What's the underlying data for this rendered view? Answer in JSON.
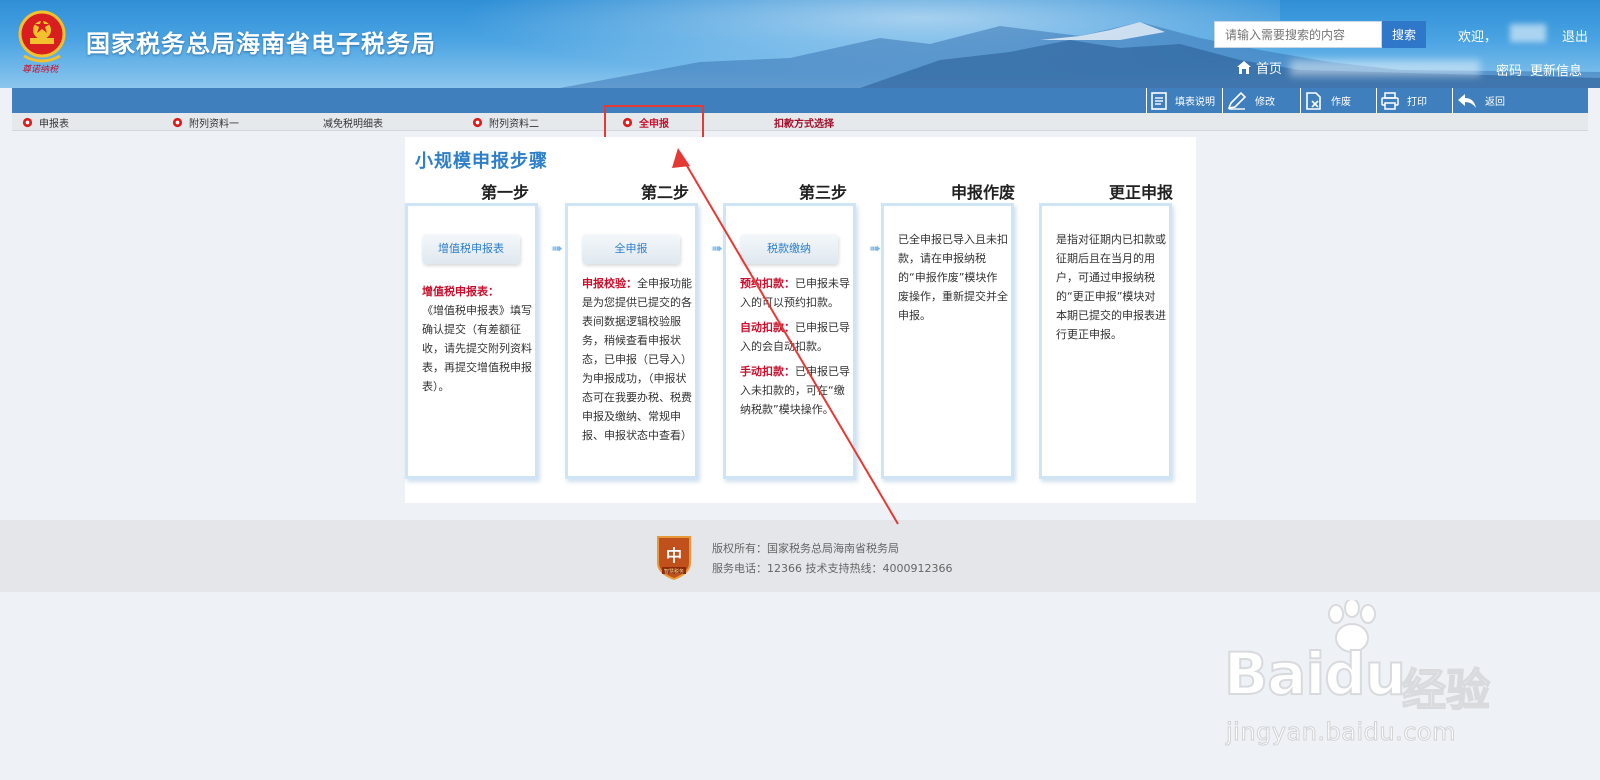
{
  "header": {
    "site_title": "国家税务总局海南省电子税务局",
    "emblem_subtitle": "尊诺纳税",
    "search_placeholder": "请输入需要搜索的内容",
    "search_button": "搜索",
    "welcome": "欢迎，",
    "logout": "退出",
    "home": "首页",
    "password_suffix": "密码",
    "update_info": "更新信息"
  },
  "toolbar": {
    "items": [
      "填表说明",
      "修改",
      "作废",
      "打印",
      "返回"
    ]
  },
  "tabs": {
    "items": [
      "申报表",
      "附列资料一",
      "减免税明细表",
      "附列资料二",
      "全申报",
      "扣款方式选择"
    ]
  },
  "steps": {
    "title": "小规模申报步骤",
    "columns": [
      {
        "head": "第一步",
        "pill": "增值税申报表",
        "red_label": "增值税申报表：",
        "text": "《增值税申报表》填写确认提交（有差额征收，请先提交附列资料表，再提交增值税申报表）。"
      },
      {
        "head": "第二步",
        "pill": "全申报",
        "red_label": "申报校验：",
        "text": "全申报功能是为您提供已提交的各表间数据逻辑校验服务，稍候查看申报状态，已申报（已导入）为申报成功，（申报状态可在我要办税、税费申报及缴纳、常规申报、申报状态中查看）"
      },
      {
        "head": "第三步",
        "pill": "税款缴纳",
        "parts": [
          {
            "red": "预约扣款：",
            "text": "已申报未导入的可以预约扣款。"
          },
          {
            "red": "自动扣款：",
            "text": "已申报已导入的会自动扣款。"
          },
          {
            "red": "手动扣款：",
            "text": "已申报已导入未扣款的，可在“缴纳税款”模块操作。"
          }
        ]
      },
      {
        "head": "申报作废",
        "text": "已全申报已导入且未扣款，请在申报纳税的“申报作废”模块作废操作，重新提交并全申报。"
      },
      {
        "head": "更正申报",
        "text": "是指对征期内已扣款或征期后且在当月的用户，可通过申报纳税的“更正申报”模块对本期已提交的申报表进行更正申报。"
      }
    ]
  },
  "footer": {
    "badge_text": "智慧税务",
    "copyright": "版权所有：国家税务总局海南省税务局",
    "service": "服务电话：12366 技术支持热线：4000912366"
  },
  "watermark": {
    "brand": "Baidu",
    "brand_cn": "经验",
    "url": "jingyan.baidu.com"
  },
  "colors": {
    "header_blue": "#2f8fd6",
    "toolbar_blue": "#3f7fbd",
    "accent_red": "#c8102e",
    "title_blue": "#2e7fc8"
  }
}
